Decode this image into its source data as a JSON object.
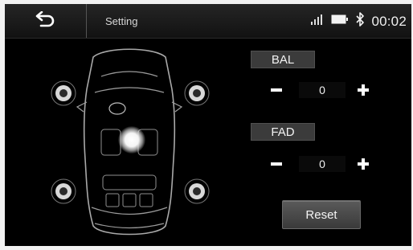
{
  "header": {
    "title": "Setting",
    "time": "00:02",
    "icons": [
      "back-arrow-icon",
      "signal-icon",
      "battery-icon",
      "bluetooth-icon"
    ]
  },
  "controls": {
    "balance": {
      "label": "BAL",
      "value": "0"
    },
    "fader": {
      "label": "FAD",
      "value": "0"
    },
    "reset_label": "Reset"
  },
  "diagram": {
    "speakers": [
      "front-left",
      "front-right",
      "rear-left",
      "rear-right"
    ],
    "sound_focus": "center"
  },
  "colors": {
    "background": "#000000",
    "topbar": "#1b1b1b",
    "text": "#f0f0f0"
  }
}
